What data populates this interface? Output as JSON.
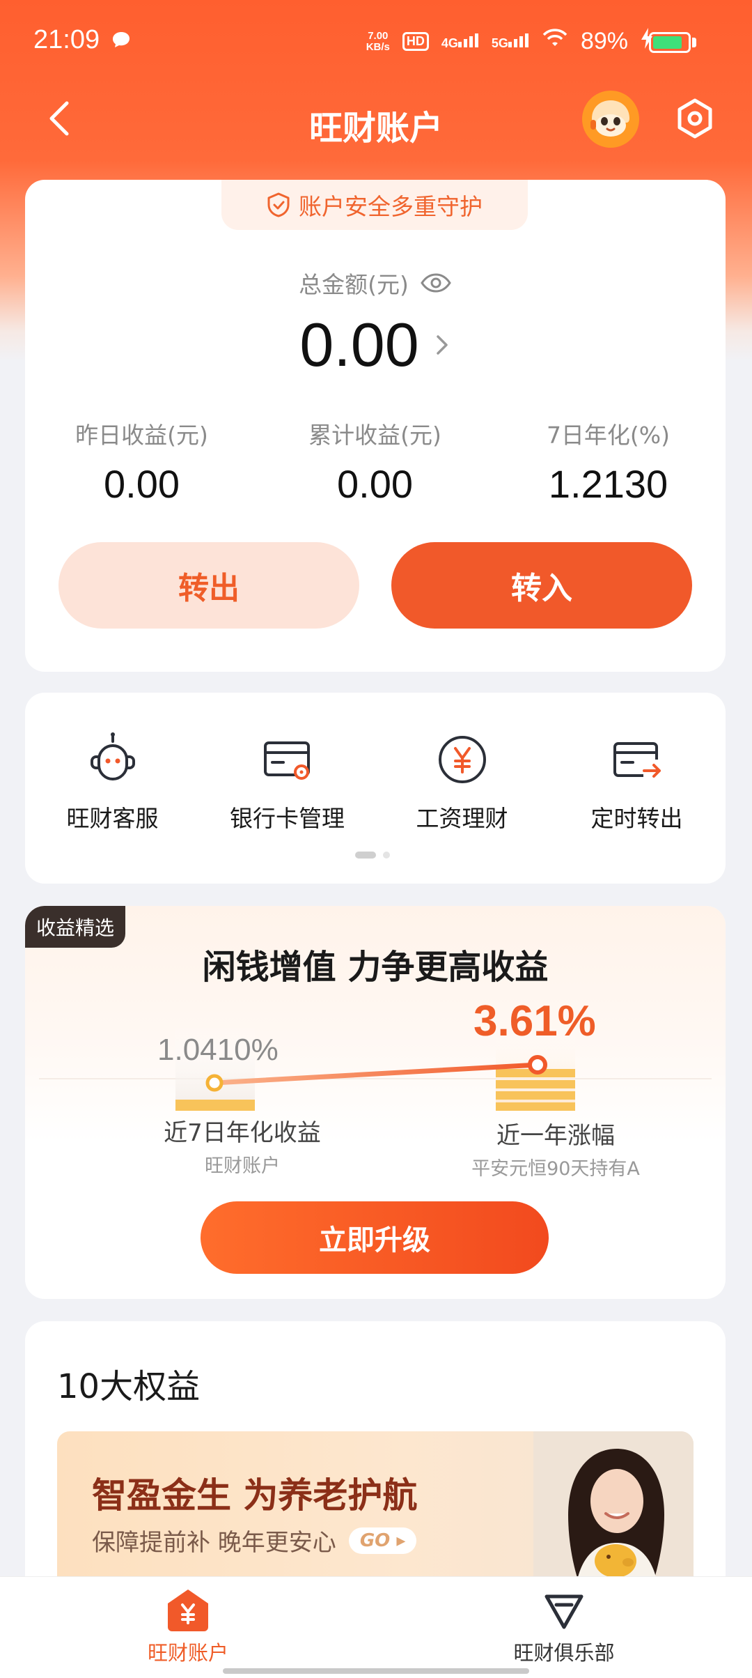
{
  "status_bar": {
    "time": "21:09",
    "speed_value": "7.00",
    "speed_unit": "KB/s",
    "hd": "HD",
    "net1": "4G",
    "net2": "5G",
    "battery": "89%"
  },
  "header": {
    "title": "旺财账户"
  },
  "account": {
    "security_tag": "账户安全多重守护",
    "total_label": "总金额(元)",
    "total_amount": "0.00",
    "stats": [
      {
        "label": "昨日收益(元)",
        "value": "0.00"
      },
      {
        "label": "累计收益(元)",
        "value": "0.00"
      },
      {
        "label": "7日年化(%)",
        "value": "1.2130"
      }
    ],
    "transfer_out": "转出",
    "transfer_in": "转入"
  },
  "services": [
    {
      "label": "旺财客服",
      "icon": "customer-service-icon"
    },
    {
      "label": "银行卡管理",
      "icon": "bank-card-icon"
    },
    {
      "label": "工资理财",
      "icon": "yuan-coin-icon"
    },
    {
      "label": "定时转出",
      "icon": "scheduled-transfer-icon"
    }
  ],
  "promo": {
    "badge": "收益精选",
    "title": "闲钱增值 力争更高收益",
    "left_rate": "1.0410%",
    "left_caption": "近7日年化收益",
    "left_sub": "旺财账户",
    "right_rate": "3.61%",
    "right_caption": "近一年涨幅",
    "right_sub": "平安元恒90天持有A",
    "cta": "立即升级"
  },
  "benefits": {
    "title": "10大权益",
    "banner_title": "智盈金生 为养老护航",
    "banner_sub": "保障提前补 晚年更安心",
    "banner_go": "GO"
  },
  "bottom_nav": [
    {
      "label": "旺财账户",
      "active": true
    },
    {
      "label": "旺财俱乐部",
      "active": false
    }
  ],
  "colors": {
    "brand": "#f1592a",
    "brand_light": "#fde3d8",
    "battery": "#3ee07a"
  }
}
